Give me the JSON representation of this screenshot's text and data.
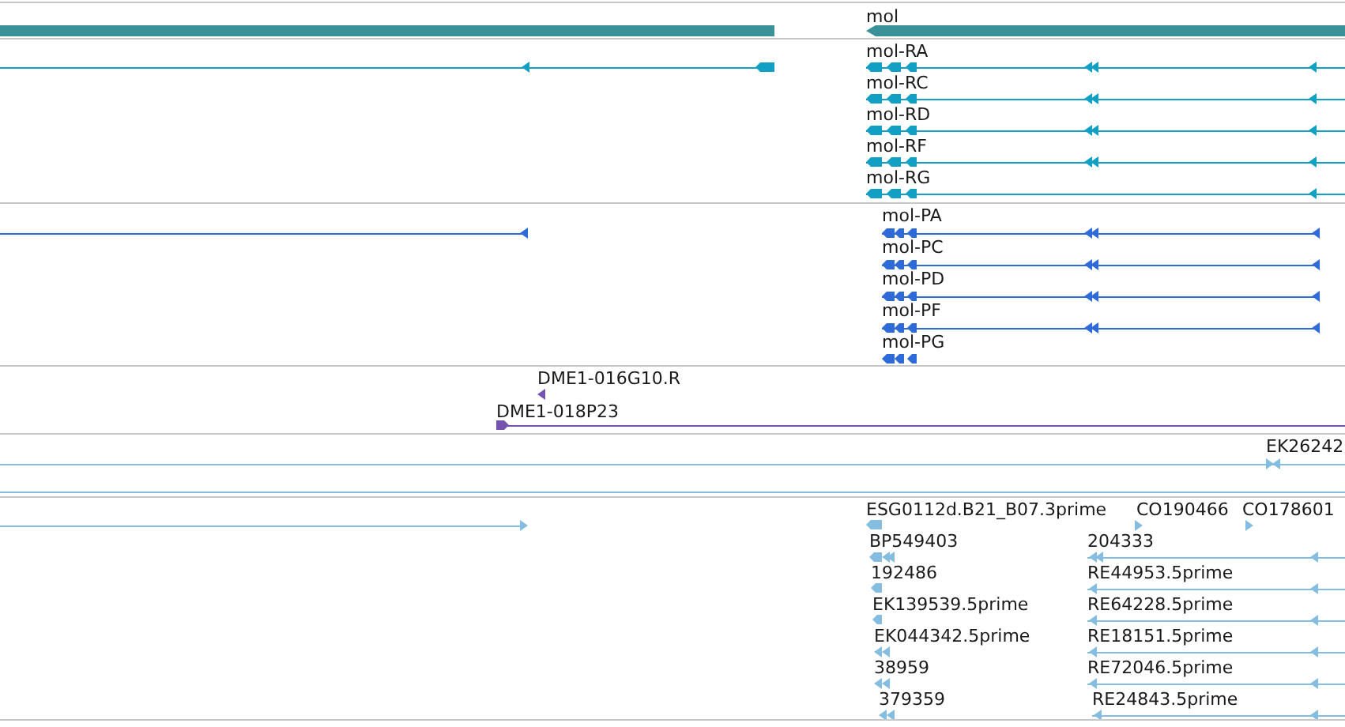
{
  "tracks": [
    {
      "kind": "gene",
      "color": "#3a9198",
      "features": [
        {
          "label": "mol"
        }
      ]
    },
    {
      "kind": "transcript",
      "color": "#11a0c4",
      "features": [
        {
          "label": "mol-RA"
        },
        {
          "label": "mol-RC"
        },
        {
          "label": "mol-RD"
        },
        {
          "label": "mol-RF"
        },
        {
          "label": "mol-RG"
        }
      ]
    },
    {
      "kind": "protein",
      "color": "#2e6bd8",
      "features": [
        {
          "label": "mol-PA"
        },
        {
          "label": "mol-PC"
        },
        {
          "label": "mol-PD"
        },
        {
          "label": "mol-PF"
        },
        {
          "label": "mol-PG"
        }
      ]
    },
    {
      "kind": "clone",
      "color": "#7352b0",
      "features": [
        {
          "label": "DME1-016G10.R"
        },
        {
          "label": "DME1-018P23"
        }
      ]
    },
    {
      "kind": "ek",
      "color": "#85bde0",
      "features": [
        {
          "label": "EK26242"
        }
      ]
    },
    {
      "kind": "est",
      "color": "#85bde0",
      "features": [
        {
          "label": "ESG0112d.B21_B07.3prime"
        },
        {
          "label": "CO190466"
        },
        {
          "label": "CO178601"
        },
        {
          "label": "BP549403"
        },
        {
          "label": "204333"
        },
        {
          "label": "192486"
        },
        {
          "label": "RE44953.5prime"
        },
        {
          "label": "EK139539.5prime"
        },
        {
          "label": "RE64228.5prime"
        },
        {
          "label": "EK044342.5prime"
        },
        {
          "label": "RE18151.5prime"
        },
        {
          "label": "38959"
        },
        {
          "label": "RE72046.5prime"
        },
        {
          "label": "379359"
        },
        {
          "label": "RE24843.5prime"
        }
      ]
    }
  ]
}
